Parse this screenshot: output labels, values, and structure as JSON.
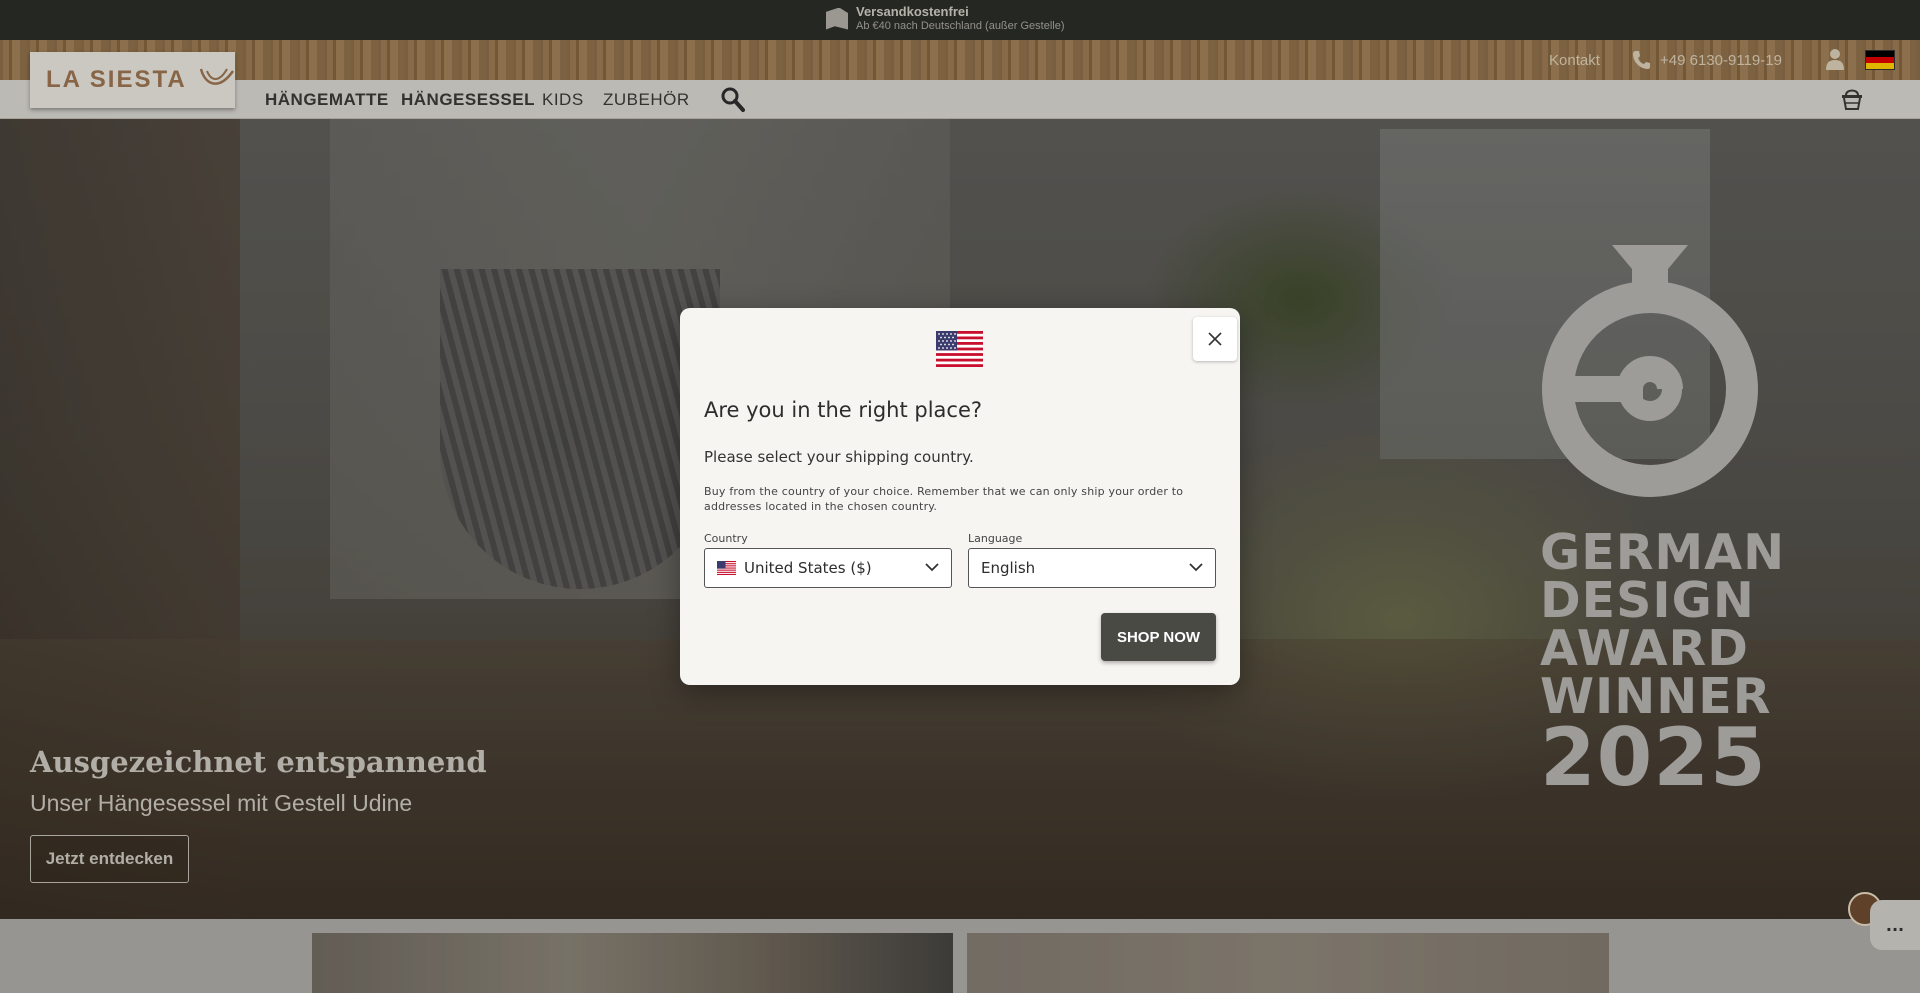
{
  "promo": {
    "title": "Versandkostenfrei",
    "subtitle": "Ab €40 nach Deutschland (außer Gestelle)"
  },
  "utility": {
    "contact": "Kontakt",
    "phone": "+49 6130-9119-19",
    "flag_colors": [
      "#000000",
      "#dd0000",
      "#ffce00"
    ]
  },
  "logo": {
    "text": "LA SIESTA"
  },
  "nav": {
    "items": [
      {
        "label": "HÄNGEMATTE"
      },
      {
        "label": "HÄNGESESSEL"
      },
      {
        "label": "KIDS"
      },
      {
        "label": "ZUBEHÖR"
      }
    ]
  },
  "hero": {
    "award_lines": [
      "GERMAN",
      "DESIGN",
      "AWARD",
      "WINNER"
    ],
    "award_year": "2025",
    "title": "Ausgezeichnet entspannend",
    "subtitle": "Unser Hängesessel mit Gestell Udine",
    "cta": "Jetzt entdecken"
  },
  "chat": {
    "label": "..."
  },
  "modal": {
    "title": "Are you in the right place?",
    "prompt": "Please select your shipping country.",
    "note": "Buy from the country of your choice. Remember that we can only ship your order to addresses located in the chosen country.",
    "country_label": "Country",
    "country_value": "United States ($)",
    "language_label": "Language",
    "language_value": "English",
    "shop_button": "SHOP NOW"
  },
  "colors": {
    "promo_bg": "#2b2d28",
    "nav_bg": "#d6d4cf",
    "button_dark": "#4a4a44",
    "modal_bg": "#f7f5f1"
  },
  "icons": {
    "promo": "package-icon",
    "phone": "phone-icon",
    "account": "user-icon",
    "search": "search-icon",
    "cart": "basket-icon",
    "close": "close-icon",
    "chevron": "chevron-down-icon",
    "flag_us": "us-flag-icon",
    "flag_de": "de-flag-icon"
  }
}
